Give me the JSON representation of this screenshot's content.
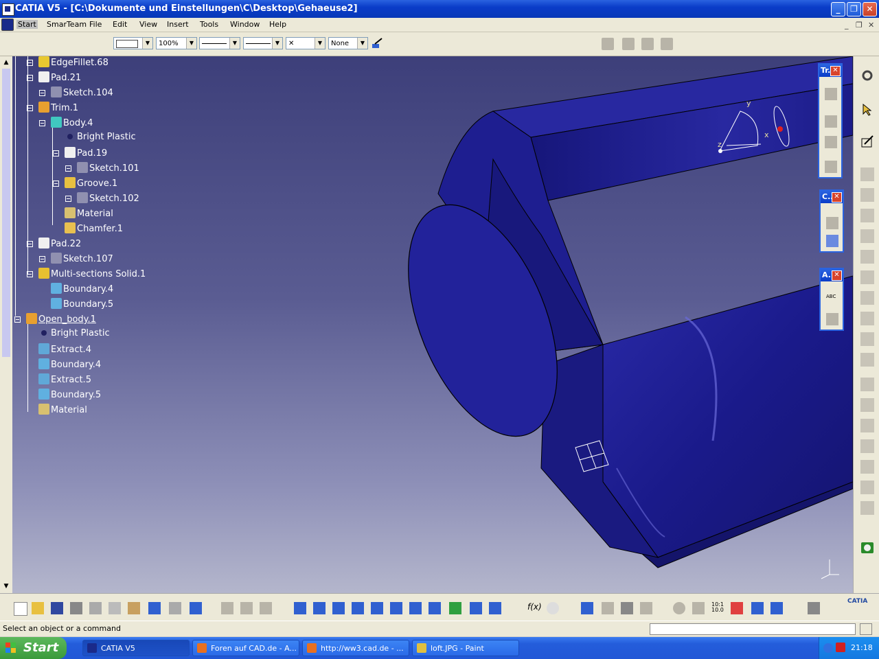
{
  "window": {
    "title": "CATIA V5 - [C:\\Dokumente und Einstellungen\\C\\Desktop\\Gehaeuse2]",
    "minimize": "_",
    "maximize": "❐",
    "close": "✕"
  },
  "menu": {
    "items": [
      "Start",
      "SmarTeam",
      "File",
      "Edit",
      "View",
      "Insert",
      "Tools",
      "Window",
      "Help"
    ],
    "doc_controls": [
      "_",
      "❐",
      "✕"
    ]
  },
  "toolbar": {
    "zoom": "100%",
    "layer": "None",
    "point_style": "✕"
  },
  "tree": {
    "nodes": [
      {
        "label": "EdgeFillet.68",
        "icon": "edge-fillet-icon",
        "color": "#e8c830"
      },
      {
        "label": "Pad.21",
        "icon": "pad-icon",
        "color": "#f0f0f0"
      },
      {
        "label": "Sketch.104",
        "icon": "sketch-icon",
        "color": "#9090b0"
      },
      {
        "label": "Trim.1",
        "icon": "trim-icon",
        "color": "#e8a030"
      },
      {
        "label": "Body.4",
        "icon": "body-icon",
        "color": "#40c8c0"
      },
      {
        "label": "Bright Plastic",
        "icon": "material-dot-icon",
        "color": "#202060"
      },
      {
        "label": "Pad.19",
        "icon": "pad-icon",
        "color": "#f0f0f0"
      },
      {
        "label": "Sketch.101",
        "icon": "sketch-icon",
        "color": "#9090b0"
      },
      {
        "label": "Groove.1",
        "icon": "groove-icon",
        "color": "#e8c040"
      },
      {
        "label": "Sketch.102",
        "icon": "sketch-icon",
        "color": "#9090b0"
      },
      {
        "label": "Material",
        "icon": "material-icon",
        "color": "#d8c070"
      },
      {
        "label": "Chamfer.1",
        "icon": "chamfer-icon",
        "color": "#e8c050"
      },
      {
        "label": "Pad.22",
        "icon": "pad-icon",
        "color": "#f0f0f0"
      },
      {
        "label": "Sketch.107",
        "icon": "sketch-icon",
        "color": "#9090b0"
      },
      {
        "label": "Multi-sections Solid.1",
        "icon": "loft-icon",
        "color": "#e8c030"
      },
      {
        "label": "Boundary.4",
        "icon": "boundary-icon",
        "color": "#60b0e0"
      },
      {
        "label": "Boundary.5",
        "icon": "boundary-icon",
        "color": "#60b0e0"
      },
      {
        "label": "Open_body.1",
        "icon": "open-body-icon",
        "color": "#e8a030"
      },
      {
        "label": "Bright Plastic",
        "icon": "material-dot-icon",
        "color": "#202060"
      },
      {
        "label": "Extract.4",
        "icon": "extract-icon",
        "color": "#60a8d8"
      },
      {
        "label": "Boundary.4",
        "icon": "boundary-icon",
        "color": "#60b0e0"
      },
      {
        "label": "Extract.5",
        "icon": "extract-icon",
        "color": "#60a8d8"
      },
      {
        "label": "Boundary.5",
        "icon": "boundary-icon",
        "color": "#60b0e0"
      },
      {
        "label": "Material",
        "icon": "material-icon",
        "color": "#d8c070"
      }
    ]
  },
  "panels": {
    "transform": "Tr...",
    "constraint": "C...",
    "annotation": "A...",
    "close": "✕"
  },
  "compass": {
    "x": "x",
    "y": "y",
    "z": "z"
  },
  "status": {
    "message": "Select an object or a command"
  },
  "taskbar": {
    "start": "Start",
    "items": [
      {
        "label": "CATIA V5",
        "icon": "catia-app-icon"
      },
      {
        "label": "Foren auf CAD.de - A...",
        "icon": "firefox-icon"
      },
      {
        "label": "http://ww3.cad.de - ...",
        "icon": "firefox-icon"
      },
      {
        "label": "loft.JPG - Paint",
        "icon": "paint-icon"
      }
    ],
    "clock": "21:18"
  },
  "colors": {
    "part": "#1e1e8c",
    "part_highlight": "#4646c8",
    "background_top": "#3d3f7a",
    "background_bottom": "#b4b6cc"
  }
}
